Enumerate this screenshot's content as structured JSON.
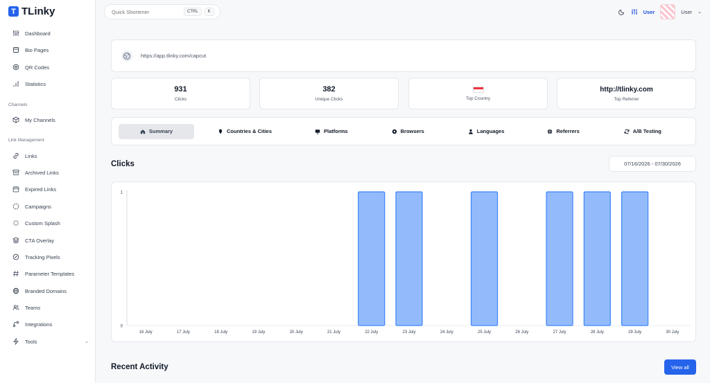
{
  "brand": {
    "name": "TLinky"
  },
  "sidebar": {
    "items": [
      {
        "label": "Dashboard",
        "icon": "dashboard-icon"
      },
      {
        "label": "Bio Pages",
        "icon": "bio-pages-icon"
      },
      {
        "label": "QR Codes",
        "icon": "qr-code-icon"
      },
      {
        "label": "Statistics",
        "icon": "statistics-icon"
      }
    ],
    "section_channels": "Channels",
    "channels": [
      {
        "label": "My Channels",
        "icon": "cube-icon"
      }
    ],
    "section_links": "Link Management",
    "links": [
      {
        "label": "Links",
        "icon": "link-icon"
      },
      {
        "label": "Archived Links",
        "icon": "archive-icon"
      },
      {
        "label": "Expired Links",
        "icon": "calendar-icon"
      },
      {
        "label": "Campaigns",
        "icon": "campaign-icon"
      },
      {
        "label": "Custom Splash",
        "icon": "splash-icon"
      },
      {
        "label": "CTA Overlay",
        "icon": "layers-icon"
      },
      {
        "label": "Tracking Pixels",
        "icon": "pixel-icon"
      },
      {
        "label": "Parameter Templates",
        "icon": "hash-icon"
      },
      {
        "label": "Branded Domains",
        "icon": "globe-icon"
      },
      {
        "label": "Teams",
        "icon": "users-icon"
      },
      {
        "label": "Integrations",
        "icon": "integrations-icon"
      },
      {
        "label": "Tools",
        "icon": "tools-icon"
      }
    ]
  },
  "search": {
    "placeholder": "Quick Shortener",
    "kbd1": "CTRL",
    "kbd2": "K"
  },
  "header": {
    "user_link": "User",
    "user_name": "User"
  },
  "link": {
    "url": "https://app.tlinky.com/capcut"
  },
  "stats": {
    "clicks_value": "931",
    "clicks_label": "Clicks",
    "unique_value": "382",
    "unique_label": "Unique Clicks",
    "country_label": "Top Country",
    "referrer_value": "http://tlinky.com",
    "referrer_label": "Top Referrer"
  },
  "tabs": [
    {
      "label": "Summary",
      "icon": "home-icon"
    },
    {
      "label": "Countries & Cities",
      "icon": "map-pin-icon"
    },
    {
      "label": "Platforms",
      "icon": "monitor-icon"
    },
    {
      "label": "Browsers",
      "icon": "browser-icon"
    },
    {
      "label": "Languages",
      "icon": "user-icon"
    },
    {
      "label": "Referrers",
      "icon": "globe-icon"
    },
    {
      "label": "A/B Testing",
      "icon": "refresh-icon"
    }
  ],
  "clicks_section": {
    "title": "Clicks",
    "date_range": "07/16/2026 - 07/30/2026"
  },
  "recent": {
    "title": "Recent Activity",
    "view_all": "View all"
  },
  "colors": {
    "accent": "#2563eb",
    "bar_fill": "#93bbfc",
    "bar_stroke": "#3b82f6"
  },
  "chart_data": {
    "type": "bar",
    "categories": [
      "16 July",
      "17 July",
      "18 July",
      "19 July",
      "20 July",
      "21 July",
      "22 July",
      "23 July",
      "24 July",
      "25 July",
      "26 July",
      "27 July",
      "28 July",
      "29 July",
      "30 July"
    ],
    "values": [
      0,
      0,
      0,
      0,
      0,
      0,
      1,
      1,
      0,
      1,
      0,
      1,
      1,
      1,
      0
    ],
    "ylim": [
      0,
      1
    ],
    "yticks": [
      "0",
      "1"
    ]
  }
}
